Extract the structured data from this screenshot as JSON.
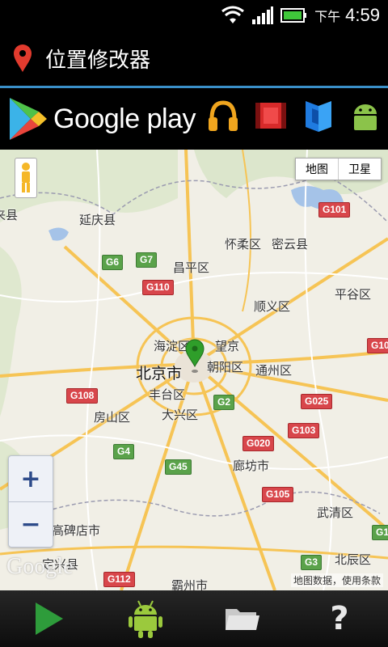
{
  "status_bar": {
    "ampm": "下午",
    "time": "4:59",
    "icons": [
      "wifi-icon",
      "signal-icon",
      "battery-icon"
    ]
  },
  "header": {
    "icon": "location-pin-icon",
    "title": "位置修改器"
  },
  "ad_banner": {
    "brand": "Google play",
    "apps": [
      "headphones-icon",
      "film-icon",
      "book-icon",
      "android-icon"
    ]
  },
  "map": {
    "type_control": {
      "map_label": "地图",
      "satellite_label": "卫星",
      "selected": "地图"
    },
    "places": {
      "laiyi": "来县",
      "yanqing": "延庆县",
      "huairou": "怀柔区",
      "miyun": "密云县",
      "changping": "昌平区",
      "shunyi": "顺义区",
      "pinggu": "平谷区",
      "haidian": "海淀区",
      "wangjing": "望京",
      "beijing": "北京市",
      "chaoyang": "朝阳区",
      "tongzhou": "通州区",
      "fengtai": "丰台区",
      "fangshan": "房山区",
      "daxing": "大兴区",
      "langfang": "廊坊市",
      "wuqing": "武清区",
      "gaobeidian": "高碑店市",
      "beichen": "北辰区",
      "dingxing": "定兴县",
      "bazhou": "霸州市"
    },
    "roads": [
      "G101",
      "G6",
      "G7",
      "G110",
      "G10",
      "G108",
      "G2",
      "G025",
      "G020",
      "G103",
      "G4",
      "G45",
      "G105",
      "G1",
      "G3",
      "G112"
    ],
    "zoom_in": "+",
    "zoom_out": "−",
    "logo": "Google",
    "attribution": "地图数据，使用条款"
  },
  "toolbar": {
    "play": "play-icon",
    "android": "android-icon",
    "folder": "folder-icon",
    "help": "?"
  },
  "colors": {
    "accent_line": "#3a8fc8",
    "pin_red": "#e23b2e",
    "marker_green": "#2f9e2a",
    "play_green": "#2e9c3b"
  }
}
